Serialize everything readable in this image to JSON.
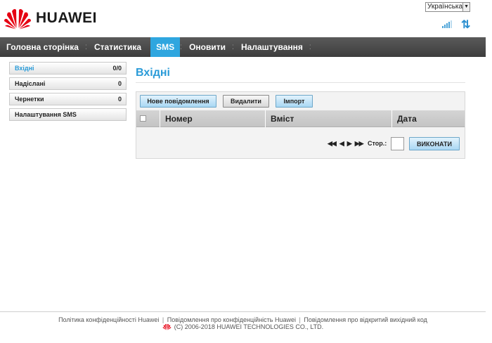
{
  "brand": {
    "name": "HUAWEI"
  },
  "language": {
    "selected": "Українська"
  },
  "nav": {
    "items": [
      {
        "label": "Головна сторінка"
      },
      {
        "label": "Статистика"
      },
      {
        "label": "SMS"
      },
      {
        "label": "Оновити"
      },
      {
        "label": "Налаштування"
      }
    ],
    "active": "SMS"
  },
  "sidebar": {
    "items": [
      {
        "label": "Вхідні",
        "count": "0/0"
      },
      {
        "label": "Надіслані",
        "count": "0"
      },
      {
        "label": "Чернетки",
        "count": "0"
      },
      {
        "label": "Налаштування SMS",
        "count": ""
      }
    ]
  },
  "main": {
    "title": "Вхідні",
    "buttons": {
      "new_message": "Нове повідомлення",
      "delete": "Видалити",
      "import": "Імпорт",
      "go": "ВИКОНАТИ"
    },
    "table": {
      "columns": [
        "Номер",
        "Вміст",
        "Дата"
      ]
    },
    "pager": {
      "page_label": "Стор.:",
      "page_value": ""
    }
  },
  "footer": {
    "links": [
      "Політика конфіденційності Huawei",
      "Повідомлення про конфіденційність Huawei",
      "Повідомлення про відкритий вихідний код"
    ],
    "copyright": "(C) 2006-2018 HUAWEI TECHNOLOGIES CO., LTD."
  },
  "colors": {
    "accent": "#2fa6df",
    "nav_bg": "#4a4a4a",
    "brand_red": "#e60012"
  }
}
